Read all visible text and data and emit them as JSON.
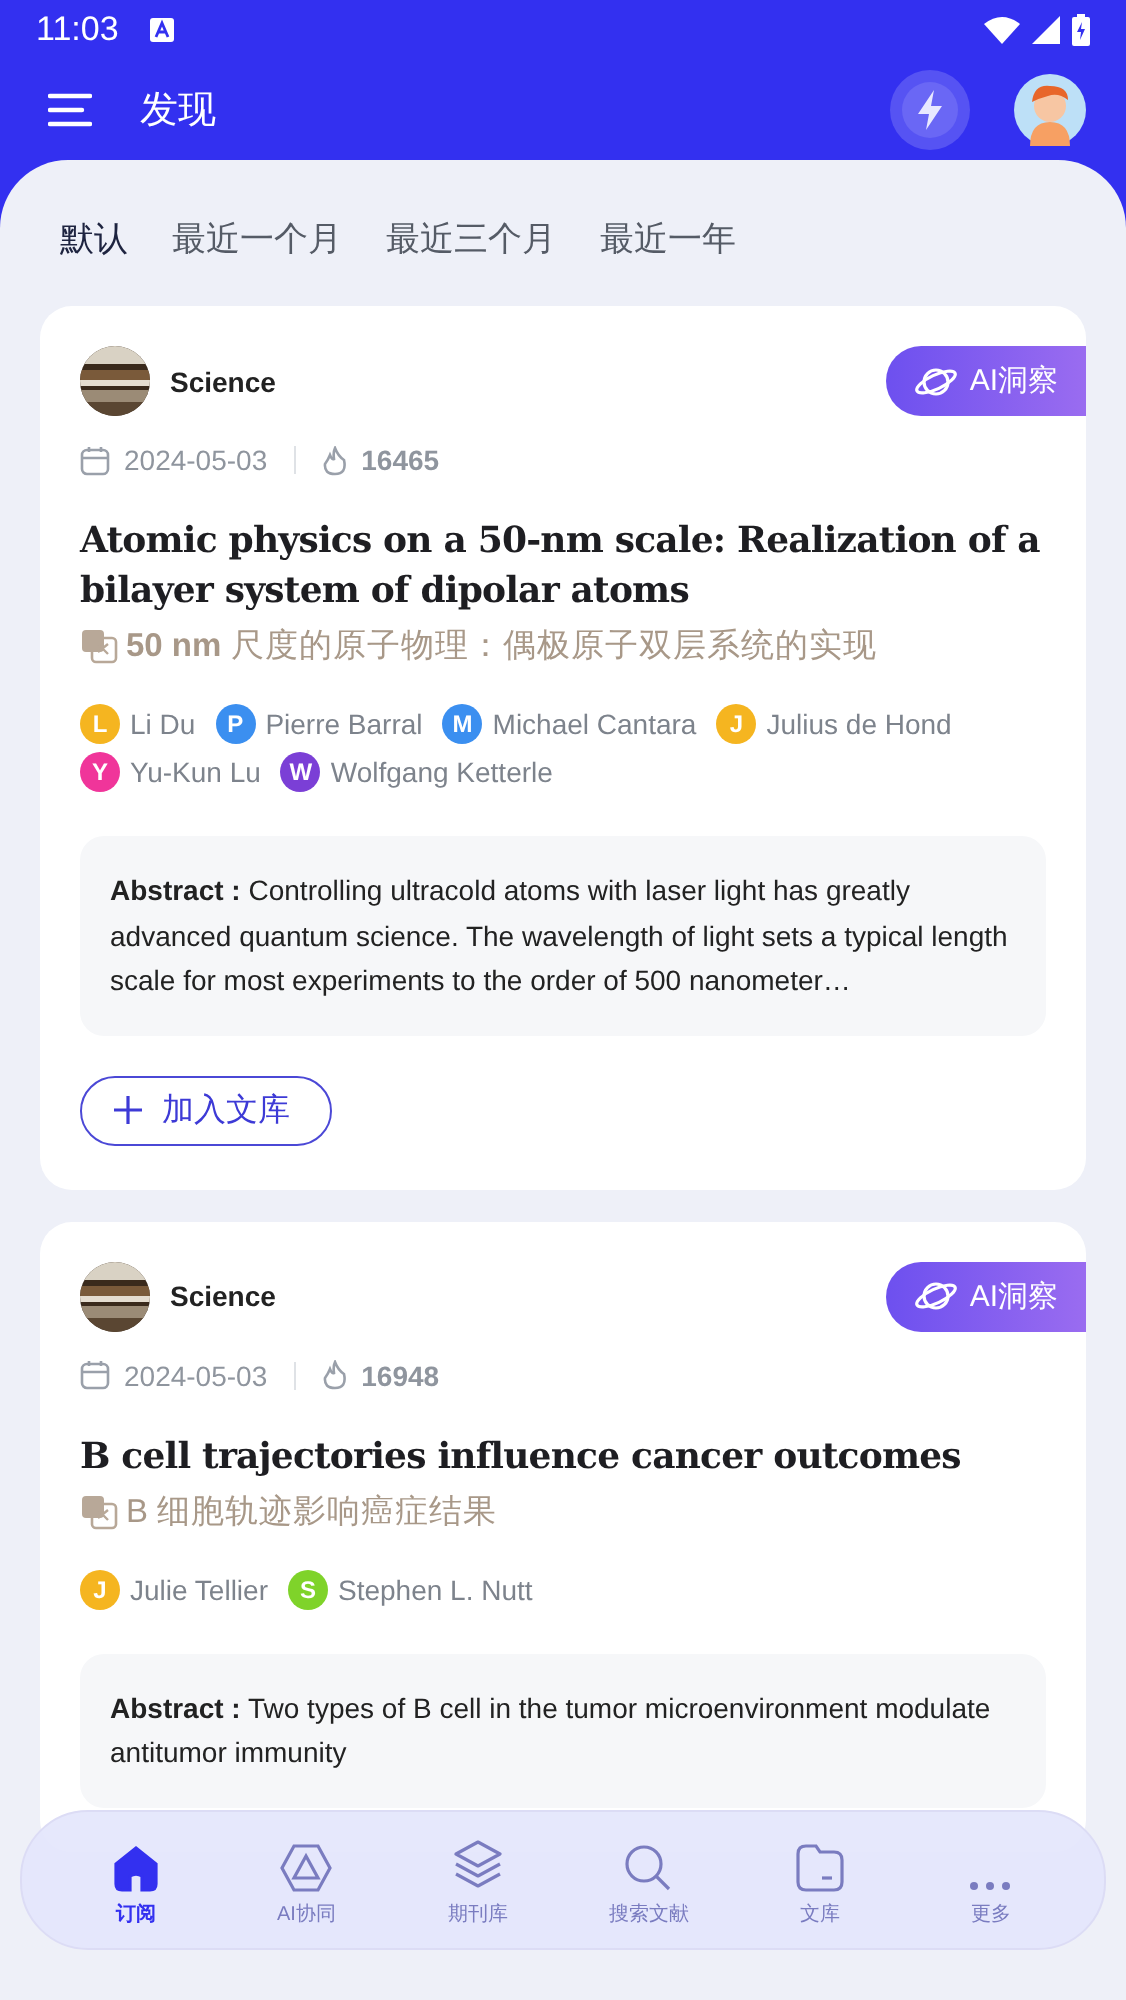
{
  "status_bar": {
    "time": "11:03"
  },
  "header": {
    "title": "发现"
  },
  "tabs": [
    {
      "label": "默认",
      "selected": true
    },
    {
      "label": "最近一个月",
      "selected": false
    },
    {
      "label": "最近三个月",
      "selected": false
    },
    {
      "label": "最近一年",
      "selected": false
    }
  ],
  "articles": [
    {
      "journal": "Science",
      "ai_button": "AI洞察",
      "date": "2024-05-03",
      "views": "16465",
      "title": "Atomic physics on a 50-nm scale: Realization of a bilayer system of dipolar atoms",
      "translation": "**50 nm** 尺度的原子物理：偶极原子双层系统的实现",
      "authors": [
        {
          "initial": "L",
          "name": "Li Du",
          "color": "#f5b520"
        },
        {
          "initial": "P",
          "name": "Pierre Barral",
          "color": "#3b8ff0"
        },
        {
          "initial": "M",
          "name": "Michael Cantara",
          "color": "#3b8ff0"
        },
        {
          "initial": "J",
          "name": "Julius de Hond",
          "color": "#f5b520"
        },
        {
          "initial": "Y",
          "name": "Yu-Kun Lu",
          "color": "#f0359a"
        },
        {
          "initial": "W",
          "name": "Wolfgang Ketterle",
          "color": "#7b3fd6"
        }
      ],
      "abstract_label": "Abstract :",
      "abstract": "Controlling ultracold atoms with laser light has greatly advanced quantum science. The wavelength of light sets a typical length scale for most experiments to the order of 500 nanometer…",
      "add_button": "加入文库"
    },
    {
      "journal": "Science",
      "ai_button": "AI洞察",
      "date": "2024-05-03",
      "views": "16948",
      "title": "B cell trajectories influence cancer outcomes",
      "translation": "B 细胞轨迹影响癌症结果",
      "authors": [
        {
          "initial": "J",
          "name": "Julie Tellier",
          "color": "#f5b520"
        },
        {
          "initial": "S",
          "name": "Stephen L. Nutt",
          "color": "#7fd32a"
        }
      ],
      "abstract_label": "Abstract :",
      "abstract": "Two types of B cell in the tumor microenvironment modulate antitumor immunity"
    }
  ],
  "bottom_nav": [
    {
      "label": "订阅",
      "kind": "home",
      "selected": true
    },
    {
      "label": "AI协同",
      "kind": "ai",
      "selected": false
    },
    {
      "label": "期刊库",
      "kind": "layers",
      "selected": false
    },
    {
      "label": "搜索文献",
      "kind": "search",
      "selected": false
    },
    {
      "label": "文库",
      "kind": "folder",
      "selected": false
    },
    {
      "label": "更多",
      "kind": "more",
      "selected": false
    }
  ]
}
